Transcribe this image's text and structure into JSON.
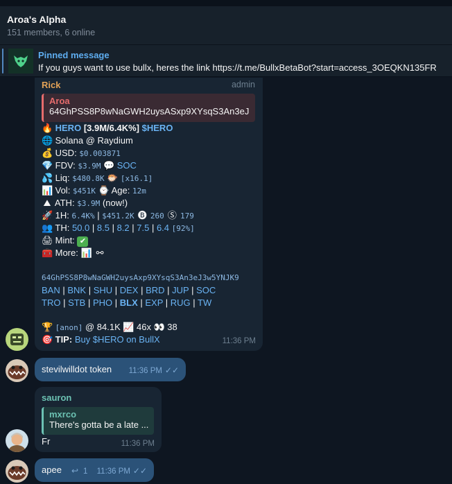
{
  "header": {
    "title": "Aroa's Alpha",
    "subtitle": "151 members, 6 online"
  },
  "pinned": {
    "label": "Pinned message",
    "text": "If you guys want to use bullx, heres the link  https://t.me/BullxBetaBot?start=access_3OEQKN135FR"
  },
  "msg1": {
    "author": "Rick",
    "role": "admin",
    "reply_author": "Aroa",
    "reply_text": "64GhPSS8P8wNaGWH2uysASxp9XYsqS3An3eJ3...",
    "token_name": "HERO",
    "token_stats": "[3.9M/6.4K%]",
    "token_tag": "$HERO",
    "chain": "Solana @ Raydium",
    "usd_label": "USD:",
    "usd": "$0.003871",
    "fdv_label": "FDV:",
    "fdv": "$3.9M",
    "soc": "SOC",
    "liq_label": "Liq:",
    "liq": "$480.8K",
    "liq_mult": "[x16.1]",
    "vol_label": "Vol:",
    "vol": "$451K",
    "age_label": "Age:",
    "age": "12m",
    "ath_label": "ATH:",
    "ath": "$3.9M",
    "ath_note": "(now!)",
    "h1_label": "1H:",
    "h1_pct": "6.4K%",
    "h1_vol": "$451.2K",
    "h1_buys": "260",
    "h1_sells": "179",
    "th_label": "TH:",
    "th_values": [
      "50.0",
      "8.5",
      "8.2",
      "7.5",
      "6.4"
    ],
    "th_total": "[92%]",
    "mint_label": "Mint:",
    "more_label": "More:",
    "address": "64GhPSS8P8wNaGWH2uysAxp9XYsqS3An3eJ3w5YNJK9",
    "links1": [
      "BAN",
      "BNK",
      "SHU",
      "DEX",
      "BRD",
      "JUP",
      "SOC"
    ],
    "links2": [
      "TRO",
      "STB",
      "PHO",
      "BLX",
      "EXP",
      "RUG",
      "TW"
    ],
    "anon": "[anon]",
    "anon_mc": "@ 84.1K",
    "mult": "46x",
    "views": "38",
    "tip_label": "TIP:",
    "tip_text": "Buy $HERO on BullX",
    "time": "11:36 PM"
  },
  "msg2": {
    "text": "stevilwilldot token",
    "time": "11:36 PM"
  },
  "msg3": {
    "author": "sauron",
    "reply_author": "mxrco",
    "reply_text": "There's gotta be a late ...",
    "text": "Fr",
    "time": "11:36 PM"
  },
  "msg4": {
    "text": "apee",
    "replies": "1",
    "time": "11:36 PM"
  },
  "colors": {
    "bg": "#0e1621",
    "panel": "#17212b",
    "bubble_in": "#182533",
    "bubble_out": "#2b5278",
    "accent": "#5eadf0",
    "rick": "#e4a357",
    "aroa": "#e66c6c",
    "sauron": "#6cc2b3"
  }
}
